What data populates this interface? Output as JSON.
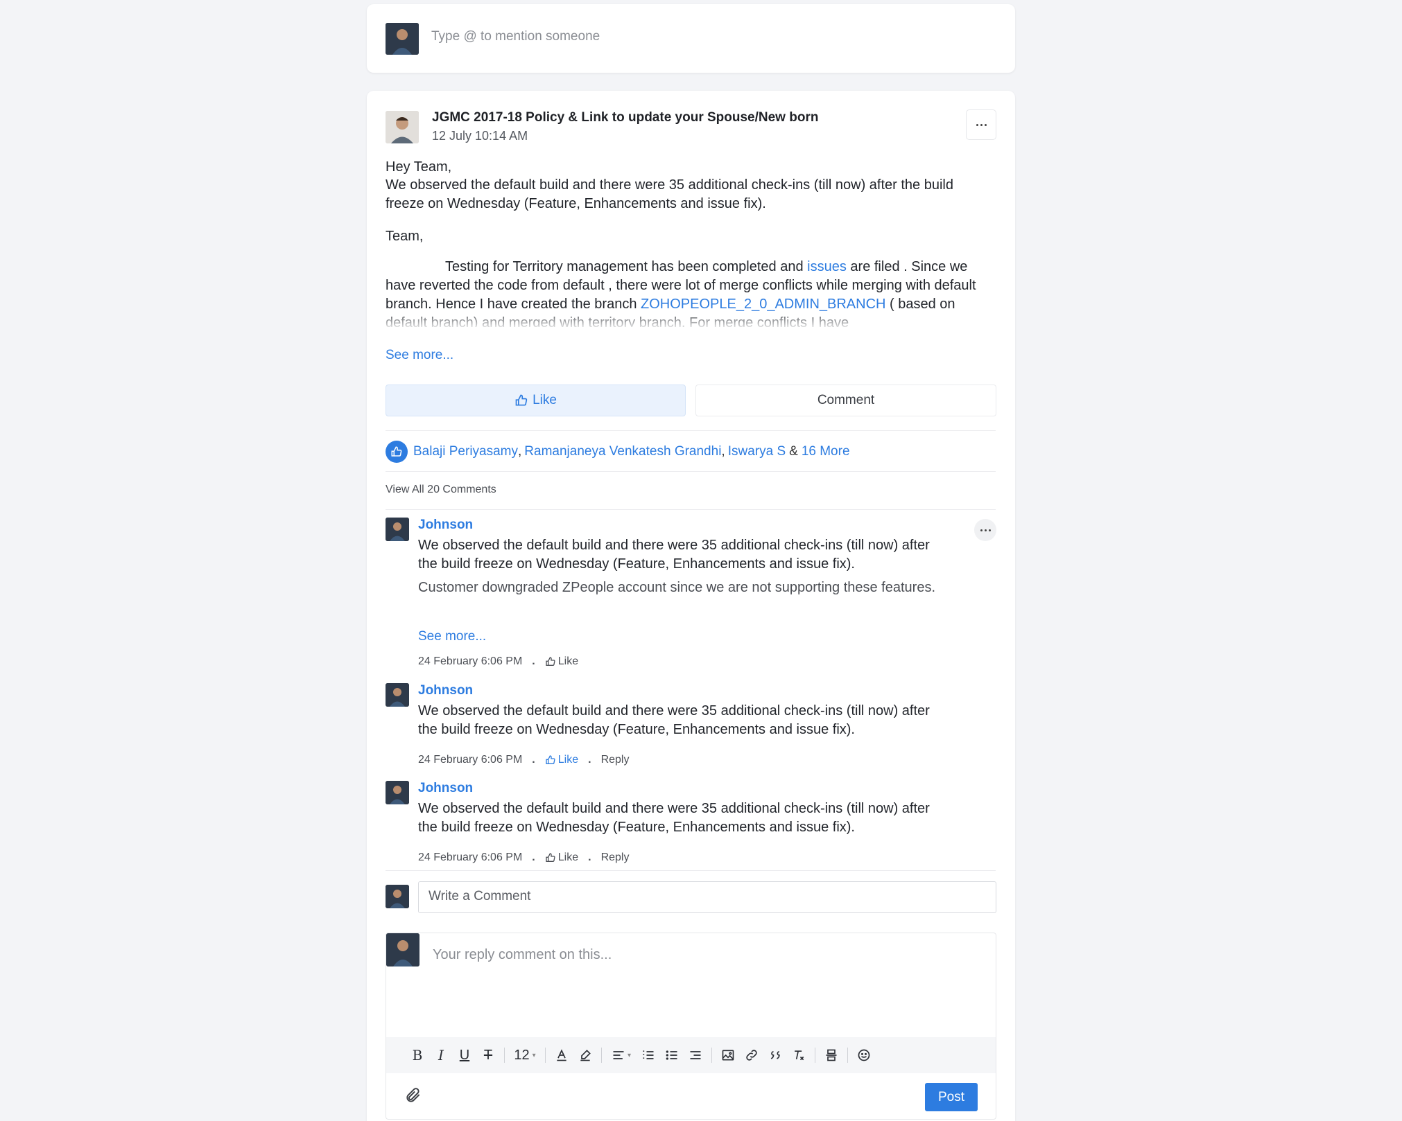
{
  "composer": {
    "placeholder": "Type @ to mention someone"
  },
  "post": {
    "title": "JGMC 2017-18 Policy & Link to update your Spouse/New born",
    "date": "12 July 10:14 AM",
    "greeting": "Hey Team,",
    "para1": "We observed the default build and there were 35 additional check-ins (till now) after the build freeze on Wednesday (Feature, Enhancements and issue fix).",
    "team": "Team,",
    "para2_part1": "Testing for Territory management has been completed and ",
    "para2_link1": "issues",
    "para2_part2": " are filed .  Since we have reverted the code from default , there were lot of merge conflicts while merging with default branch. Hence I have created the branch ",
    "para2_link2": "ZOHOPEOPLE_2_0_ADMIN_BRANCH",
    "para2_part3": " ( based on default branch) and merged with territory branch. For merge conflicts I have",
    "see_more": "See more...",
    "like_label": "Like",
    "comment_label": "Comment"
  },
  "likes": {
    "names": [
      "Balaji Periyasamy",
      "Ramanjaneya Venkatesh Grandhi",
      "Iswarya S"
    ],
    "amp": "&",
    "more": "16 More",
    "comma": ","
  },
  "comments_header": "View All 20 Comments",
  "comments": [
    {
      "author": "Johnson",
      "text": "We observed the default build and there were 35 additional check-ins (till now) after the build freeze on Wednesday (Feature, Enhancements and issue fix).",
      "text2": "Customer downgraded ZPeople account since we are not supporting these features.",
      "see_more": "See more...",
      "time": "24 February 6:06 PM",
      "like": "Like"
    },
    {
      "author": "Johnson",
      "text": "We observed the default build and there were 35 additional check-ins (till now) after the build freeze on Wednesday (Feature, Enhancements and issue fix).",
      "time": "24 February 6:06 PM",
      "like": "Like",
      "reply": "Reply"
    },
    {
      "author": "Johnson",
      "text": "We observed the default build and there were 35 additional check-ins (till now) after the build freeze on Wednesday (Feature, Enhancements and issue fix).",
      "time": "24 February 6:06 PM",
      "like": "Like",
      "reply": "Reply"
    }
  ],
  "write_comment": {
    "placeholder": "Write a Comment"
  },
  "reply": {
    "placeholder": "Your reply comment on this...",
    "font_size": "12",
    "post_label": "Post"
  },
  "colors": {
    "accent": "#2d7ce0",
    "background": "#f3f4f7"
  }
}
